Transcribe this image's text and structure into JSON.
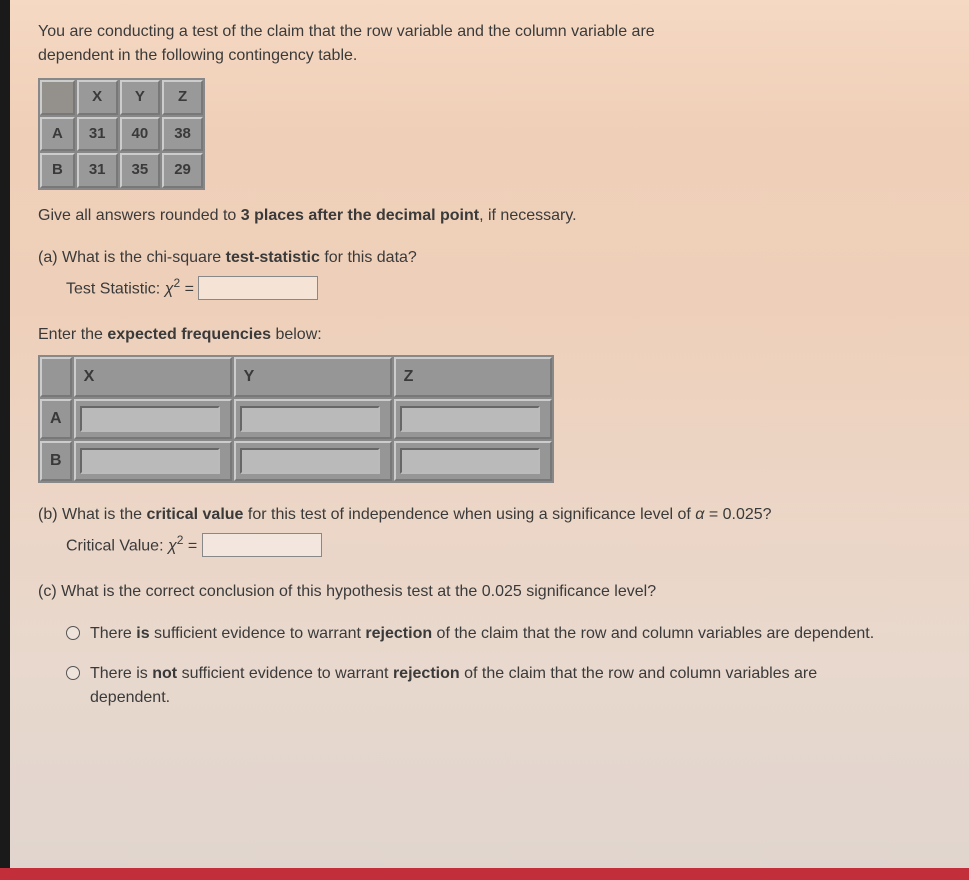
{
  "intro": {
    "line1": "You are conducting a test of the claim that the row variable and the column variable are",
    "line2": "dependent in the following contingency table."
  },
  "contingency": {
    "cols": [
      "X",
      "Y",
      "Z"
    ],
    "rows": [
      {
        "label": "A",
        "values": [
          "31",
          "40",
          "38"
        ]
      },
      {
        "label": "B",
        "values": [
          "31",
          "35",
          "29"
        ]
      }
    ]
  },
  "rounding_instr_pre": "Give all answers rounded to ",
  "rounding_instr_bold": "3 places after the decimal point",
  "rounding_instr_post": ", if necessary.",
  "partA": {
    "prompt_pre": "(a) What is the chi-square ",
    "prompt_bold": "test-statistic",
    "prompt_post": " for this data?",
    "stat_label_pre": "Test Statistic: ",
    "chi": "χ",
    "equals": " = "
  },
  "expected_label_pre": "Enter the ",
  "expected_label_bold": "expected frequencies",
  "expected_label_post": " below:",
  "expected_table": {
    "cols": [
      "X",
      "Y",
      "Z"
    ],
    "rows": [
      "A",
      "B"
    ]
  },
  "partB": {
    "prompt_pre": "(b) What is the ",
    "prompt_bold": "critical value",
    "prompt_mid": " for this test of independence when using a significance level of ",
    "alpha": "α",
    "equals_val": " = 0.025?",
    "stat_label_pre": "Critical Value: ",
    "chi": "χ",
    "equals": " = "
  },
  "partC": {
    "prompt": "(c) What is the correct conclusion of this hypothesis test at the 0.025 significance level?",
    "opt1_pre": "There ",
    "opt1_bold1": "is",
    "opt1_mid": " sufficient evidence to warrant ",
    "opt1_bold2": "rejection",
    "opt1_post": " of the claim that the row and column variables are dependent.",
    "opt2_pre": "There is ",
    "opt2_bold1": "not",
    "opt2_mid": " sufficient evidence to warrant ",
    "opt2_bold2": "rejection",
    "opt2_post": " of the claim that the row and column variables are dependent."
  }
}
